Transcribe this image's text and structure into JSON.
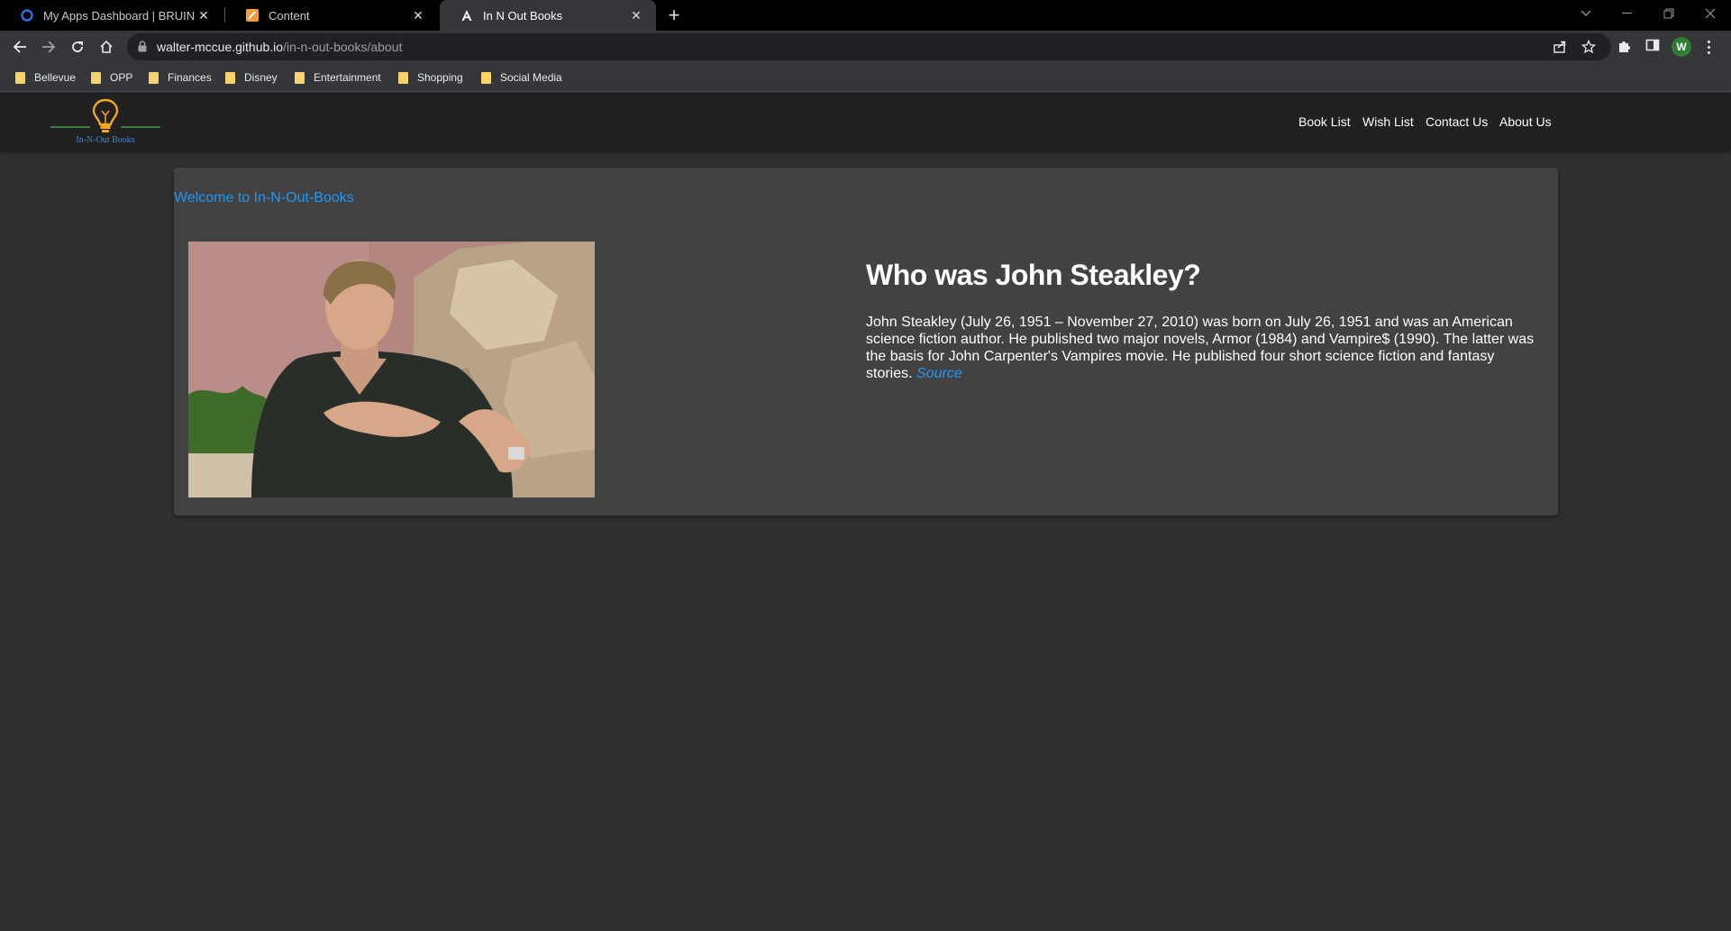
{
  "browser": {
    "tabs": [
      {
        "title": "My Apps Dashboard | BRUIN Co",
        "icon": "okta-icon"
      },
      {
        "title": "Content",
        "icon": "pencil-icon"
      },
      {
        "title": "In N Out Books",
        "icon": "angular-icon",
        "active": true
      }
    ],
    "close_glyph": "✕",
    "new_tab_glyph": "+",
    "url_host": "walter-mccue.github.io",
    "url_path": "/in-n-out-books/about",
    "profile_initial": "W",
    "bookmarks": [
      "Bellevue",
      "OPP",
      "Finances",
      "Disney",
      "Entertainment",
      "Shopping",
      "Social Media"
    ],
    "accent": "#2e7d32"
  },
  "site": {
    "brand": "In-N-Out Books",
    "nav": [
      "Book List",
      "Wish List",
      "Contact Us",
      "About Us"
    ],
    "welcome": "Welcome to In-N-Out-Books",
    "heading": "Who was John Steakley?",
    "bio": "John Steakley (July 26, 1951 – November 27, 2010) was born on July 26, 1951 and was an American science fiction author. He published two major novels, Armor (1984) and Vampire$ (1990). The latter was the basis for John Carpenter's Vampires movie. He published four short science fiction and fantasy stories.",
    "source_label": "Source",
    "link_color": "#2196f3",
    "logo_color": "#f5a623"
  }
}
